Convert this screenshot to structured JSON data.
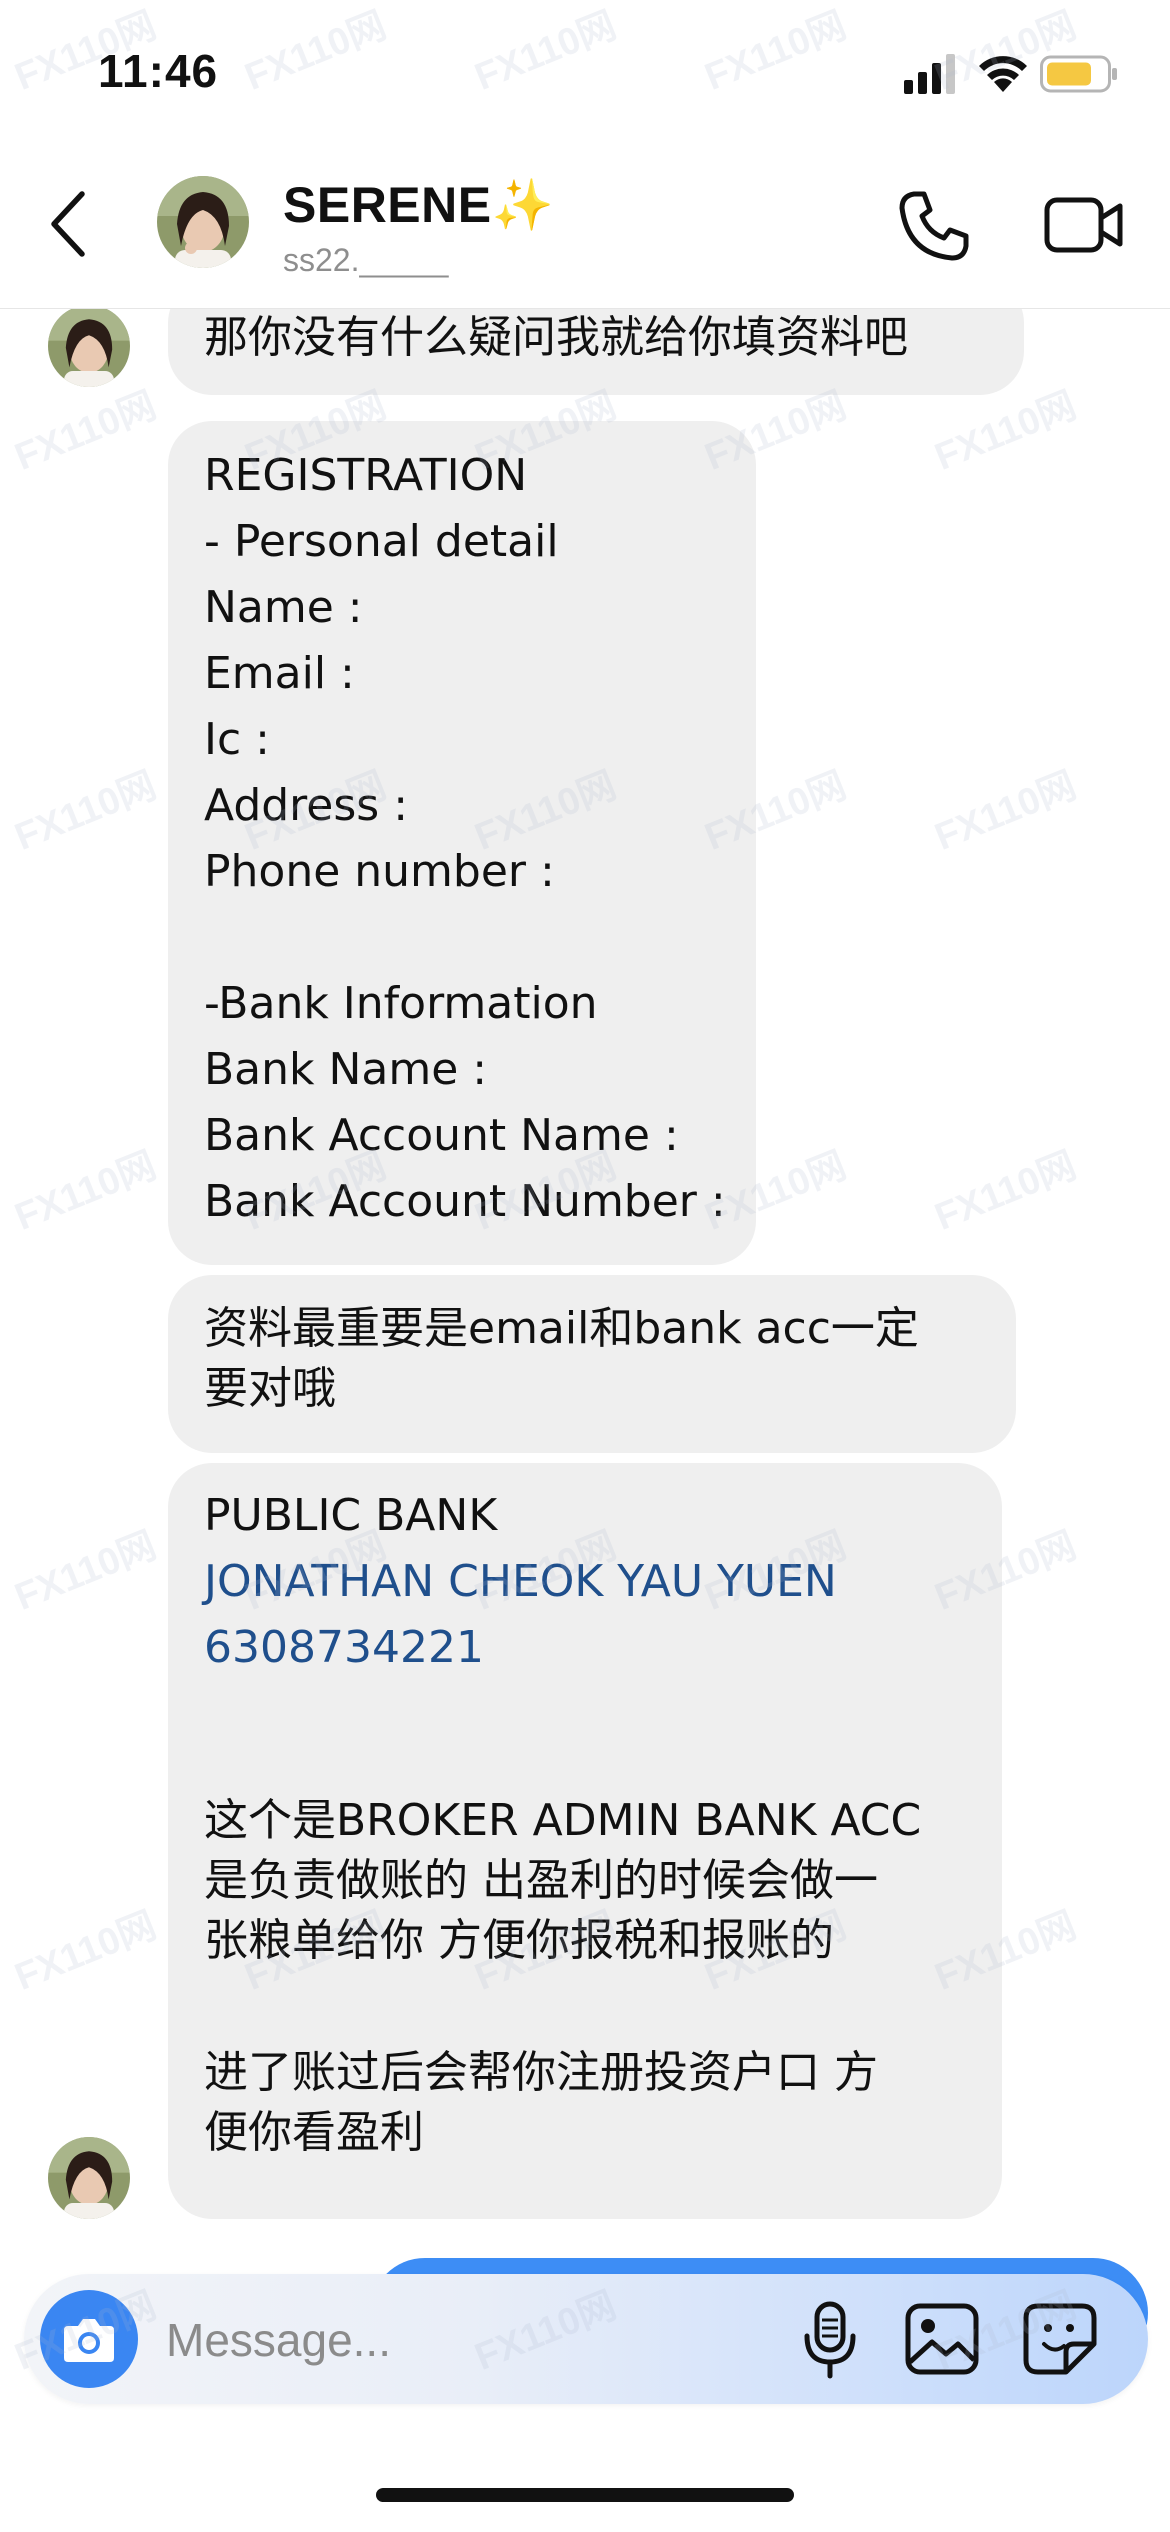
{
  "status_bar": {
    "time": "11:46",
    "icons": [
      "signal-icon",
      "wifi-icon",
      "battery-icon"
    ]
  },
  "header": {
    "name": "SERENE✨",
    "username": "ss22._____",
    "icons": [
      "back-icon",
      "phone-icon",
      "video-icon"
    ]
  },
  "messages": {
    "m1": {
      "lines": [
        "那你没有什么疑问我就给你填资料吧"
      ]
    },
    "m2": {
      "lines": [
        "REGISTRATION",
        "- Personal detail",
        "Name :",
        "Email :",
        "Ic :",
        "Address :",
        "Phone number :",
        "",
        "-Bank Information",
        "Bank Name :",
        "Bank Account Name :",
        "Bank Account Number :"
      ]
    },
    "m3": {
      "lines": [
        "资料最重要是email和bank acc一定",
        "要对哦"
      ]
    },
    "m4": {
      "bank": "PUBLIC BANK",
      "account_name": "JONATHAN CHEOK YAU YUEN",
      "account_number": "6308734221",
      "paragraph1": [
        "这个是BROKER ADMIN BANK ACC",
        "是负责做账的 出盈利的时候会做一",
        "张粮单给你 方便你报税和报账的"
      ],
      "paragraph2": [
        "进了账过后会帮你注册投资户口 方",
        "便你看盈利"
      ]
    }
  },
  "composer": {
    "placeholder": "Message...",
    "icons": [
      "camera-icon",
      "microphone-icon",
      "gallery-icon",
      "sticker-icon"
    ]
  },
  "colors": {
    "bubble": "#efefef",
    "link_text": "#1f4f8c",
    "accent_blue": "#3a86f2",
    "battery_fill": "#f5c842"
  },
  "watermark": "110网"
}
